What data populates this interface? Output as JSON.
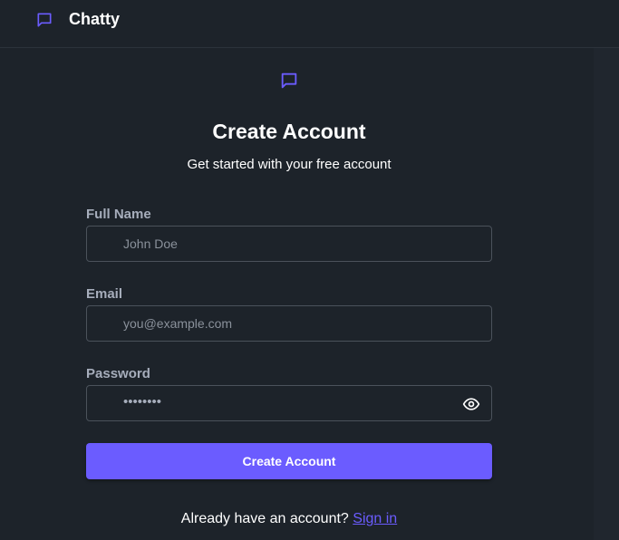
{
  "app": {
    "name": "Chatty"
  },
  "form": {
    "title": "Create Account",
    "subtitle": "Get started with your free account",
    "full_name": {
      "label": "Full Name",
      "placeholder": "John Doe",
      "value": ""
    },
    "email": {
      "label": "Email",
      "placeholder": "you@example.com",
      "value": ""
    },
    "password": {
      "label": "Password",
      "masked_value": "••••••••"
    },
    "submit_label": "Create Account"
  },
  "footer": {
    "text": "Already have an account?",
    "link_label": "Sign in"
  },
  "colors": {
    "accent": "#6b5cff",
    "background": "#1d232a"
  },
  "icons": {
    "brand": "chat-bubble-icon",
    "logo": "chat-bubble-icon",
    "password_toggle": "eye-icon"
  }
}
